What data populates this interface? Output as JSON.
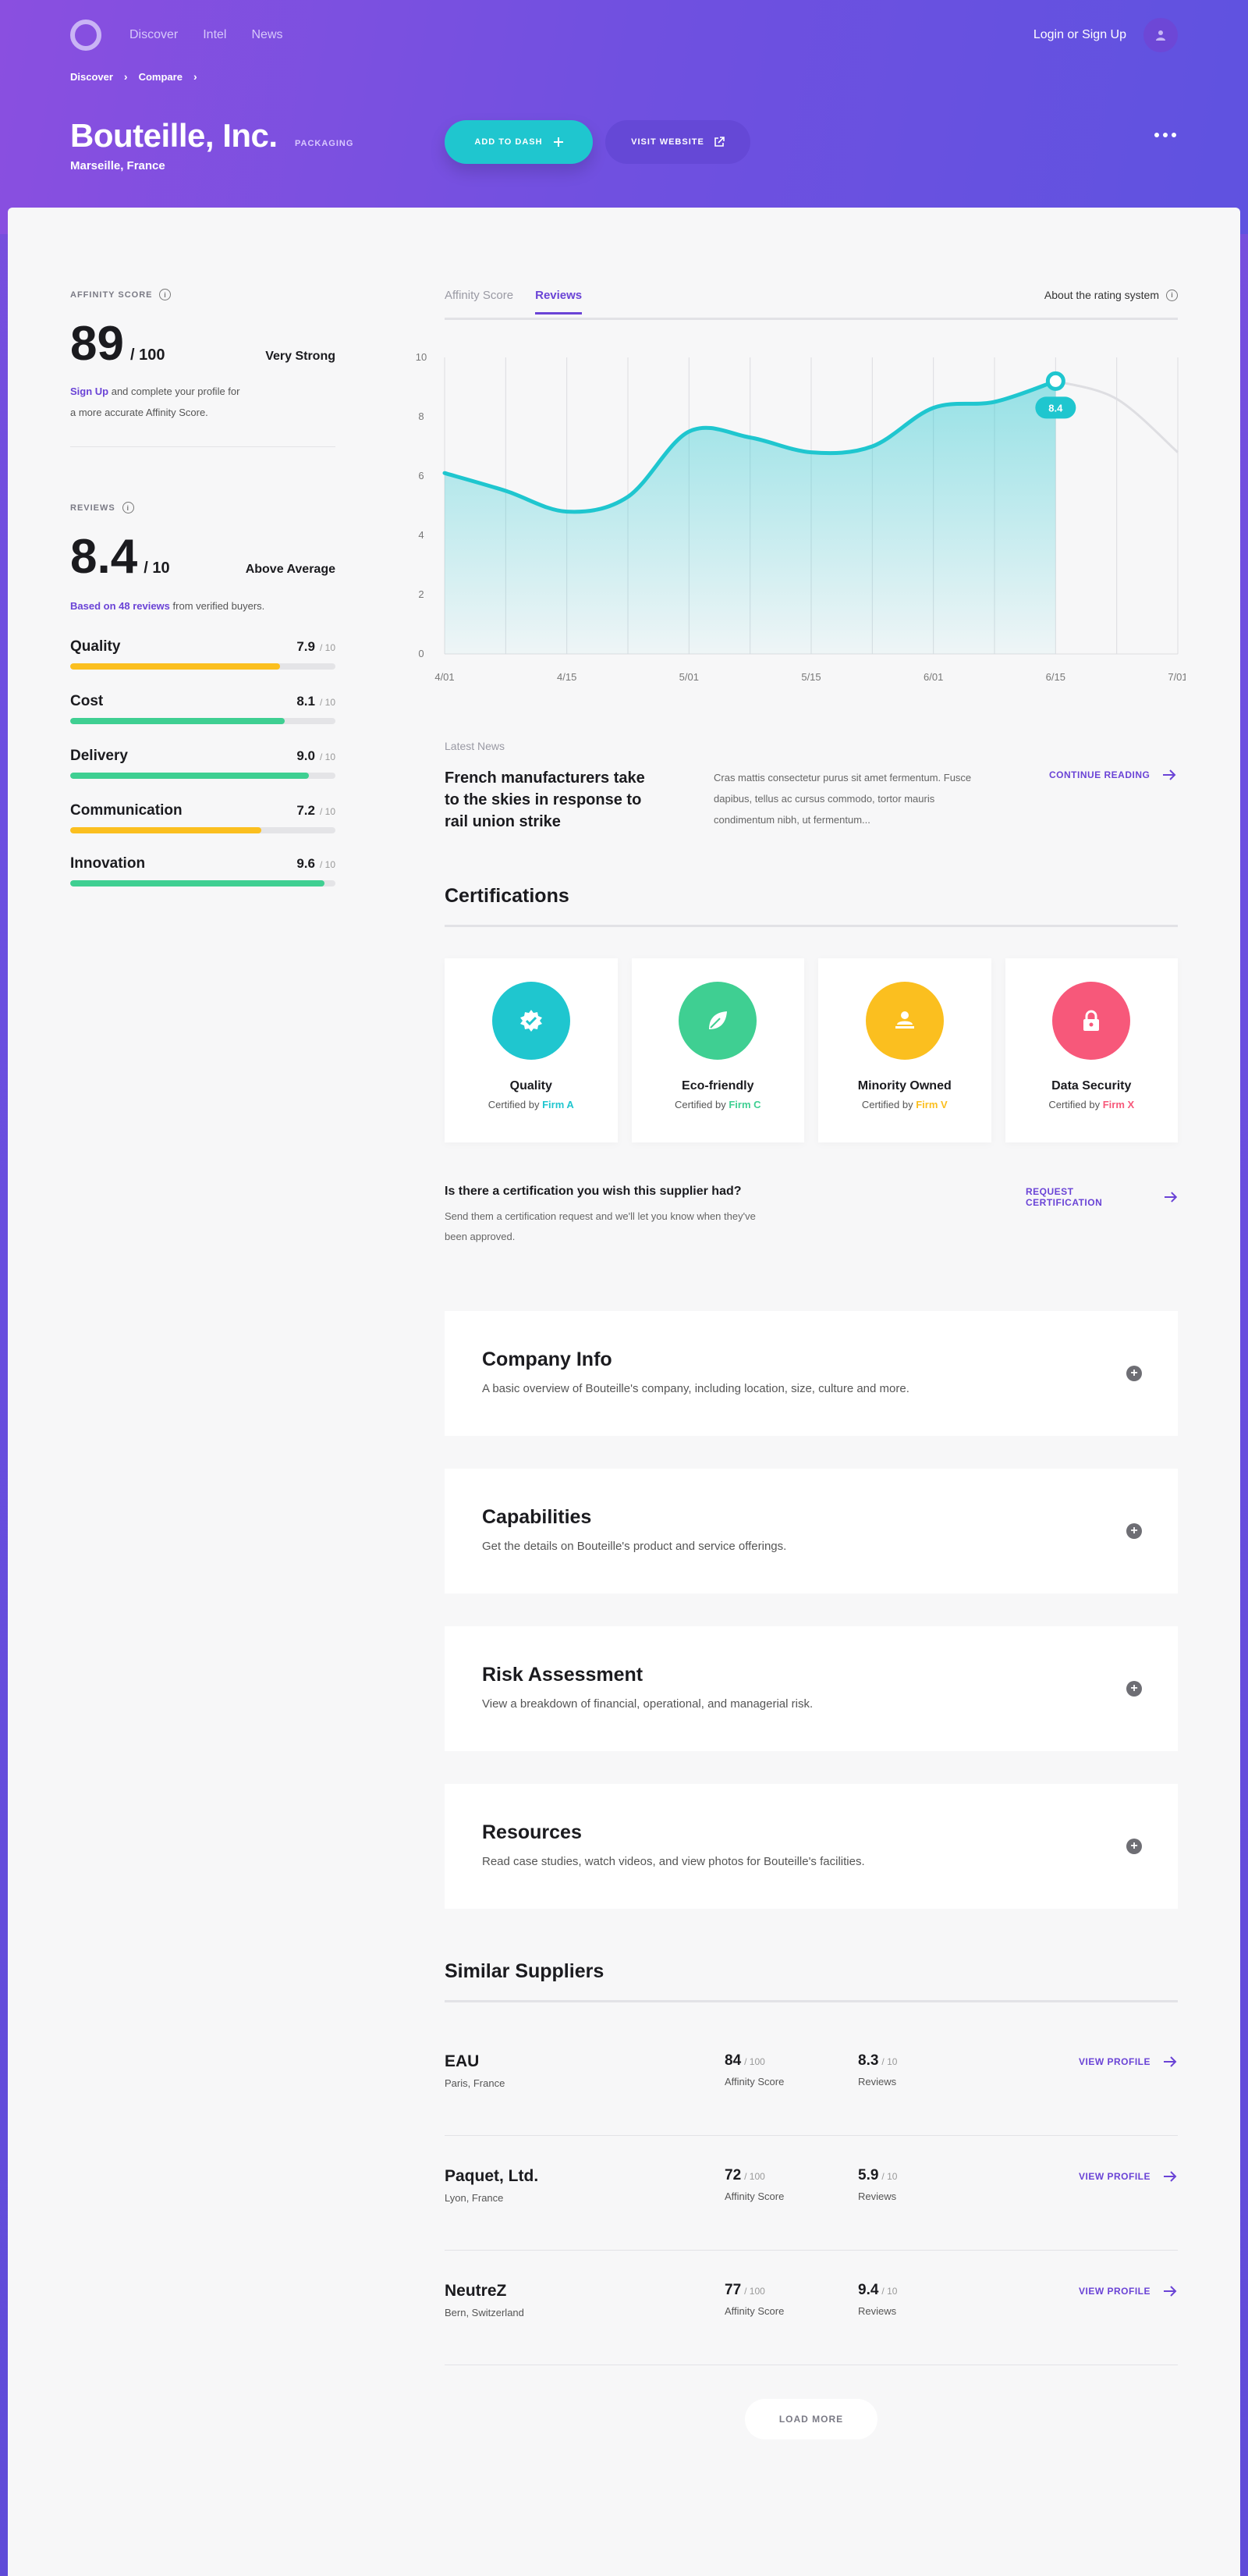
{
  "nav": {
    "links": [
      "Discover",
      "Intel",
      "News"
    ],
    "login": "Login or Sign Up"
  },
  "breadcrumb": [
    "Discover",
    "Compare"
  ],
  "company": {
    "name": "Bouteille, Inc.",
    "tag": "PACKAGING",
    "location": "Marseille, France"
  },
  "actions": {
    "add_dash": "ADD TO DASH",
    "visit_website": "VISIT WEBSITE"
  },
  "affinity": {
    "label": "AFFINITY SCORE",
    "score": "89",
    "max": "/ 100",
    "rating": "Very Strong",
    "note_link": "Sign Up",
    "note_1": " and complete your profile for",
    "note_2": "a more accurate Affinity Score."
  },
  "reviews": {
    "label": "REVIEWS",
    "score": "8.4",
    "max": "/ 10",
    "rating": "Above Average",
    "based_link": "Based on 48 reviews",
    "based_rest": " from verified buyers.",
    "max_small": "/ 10",
    "items": [
      {
        "name": "Quality",
        "value": "7.9",
        "level": 0.79,
        "color": "#fbbf1f"
      },
      {
        "name": "Cost",
        "value": "8.1",
        "level": 0.81,
        "color": "#3fcf92"
      },
      {
        "name": "Delivery",
        "value": "9.0",
        "level": 0.9,
        "color": "#3fcf92"
      },
      {
        "name": "Communication",
        "value": "7.2",
        "level": 0.72,
        "color": "#fbbf1f"
      },
      {
        "name": "Innovation",
        "value": "9.6",
        "level": 0.96,
        "color": "#3fcf92"
      }
    ]
  },
  "tabs": {
    "items": [
      "Affinity Score",
      "Reviews"
    ],
    "about": "About the rating system"
  },
  "chart_data": {
    "type": "area",
    "x": [
      "4/01",
      "4/15",
      "5/01",
      "5/15",
      "6/01",
      "6/15",
      "7/01"
    ],
    "y_ticks": [
      "10",
      "8",
      "6",
      "4",
      "2",
      "0"
    ],
    "ylim": [
      0,
      10
    ],
    "series_points": [
      [
        0,
        6.1
      ],
      [
        0.5,
        5.5
      ],
      [
        1,
        4.8
      ],
      [
        1.5,
        5.3
      ],
      [
        2,
        7.5
      ],
      [
        2.5,
        7.3
      ],
      [
        3,
        6.8
      ],
      [
        3.5,
        7.0
      ],
      [
        4,
        8.3
      ],
      [
        4.5,
        8.5
      ],
      [
        5,
        9.2
      ]
    ],
    "projection_points": [
      [
        5,
        9.2
      ],
      [
        5.5,
        8.6
      ],
      [
        6,
        6.8
      ]
    ],
    "highlight": {
      "x": 5,
      "y": 8.4,
      "label": "8.4"
    },
    "line_color": "#1fc6cf"
  },
  "news": {
    "label": "Latest News",
    "title": "French manufacturers take to the skies in response to rail union strike",
    "body": "Cras mattis consectetur purus sit amet fermentum. Fusce dapibus, tellus ac cursus commodo, tortor mauris condimentum nibh, ut fermentum...",
    "cta": "CONTINUE READING"
  },
  "certifications": {
    "title": "Certifications",
    "certified_by": "Certified by ",
    "items": [
      {
        "name": "Quality",
        "firm": "Firm A",
        "color": "#1fc6cf",
        "icon": "badge-check-icon"
      },
      {
        "name": "Eco-friendly",
        "firm": "Firm C",
        "color": "#3fcf92",
        "icon": "leaf-icon"
      },
      {
        "name": "Minority Owned",
        "firm": "Firm V",
        "color": "#fbbf1f",
        "icon": "person-icon"
      },
      {
        "name": "Data Security",
        "firm": "Firm X",
        "color": "#f7587a",
        "icon": "lock-icon"
      }
    ],
    "request_question": "Is there a certification you wish this supplier had?",
    "request_body": "Send them a certification request and we'll let you know when they've been approved.",
    "request_cta": "REQUEST CERTIFICATION"
  },
  "accordions": [
    {
      "title": "Company Info",
      "desc": "A basic overview of Bouteille's company, including location, size, culture and more."
    },
    {
      "title": "Capabilities",
      "desc": "Get the details on Bouteille's product and service offerings."
    },
    {
      "title": "Risk Assessment",
      "desc": "View a breakdown of financial, operational, and managerial risk."
    },
    {
      "title": "Resources",
      "desc": "Read case studies, watch videos, and view photos for Bouteille's facilities."
    }
  ],
  "similar": {
    "title": "Similar Suppliers",
    "affinity_caption": "Affinity Score",
    "reviews_caption": "Reviews",
    "affinity_max": "/ 100",
    "reviews_max": "/ 10",
    "cta": "VIEW PROFILE",
    "load_more": "LOAD MORE",
    "items": [
      {
        "name": "EAU",
        "location": "Paris, France",
        "affinity": "84",
        "reviews": "8.3"
      },
      {
        "name": "Paquet, Ltd.",
        "location": "Lyon, France",
        "affinity": "72",
        "reviews": "5.9"
      },
      {
        "name": "NeutreZ",
        "location": "Bern, Switzerland",
        "affinity": "77",
        "reviews": "9.4"
      }
    ]
  }
}
